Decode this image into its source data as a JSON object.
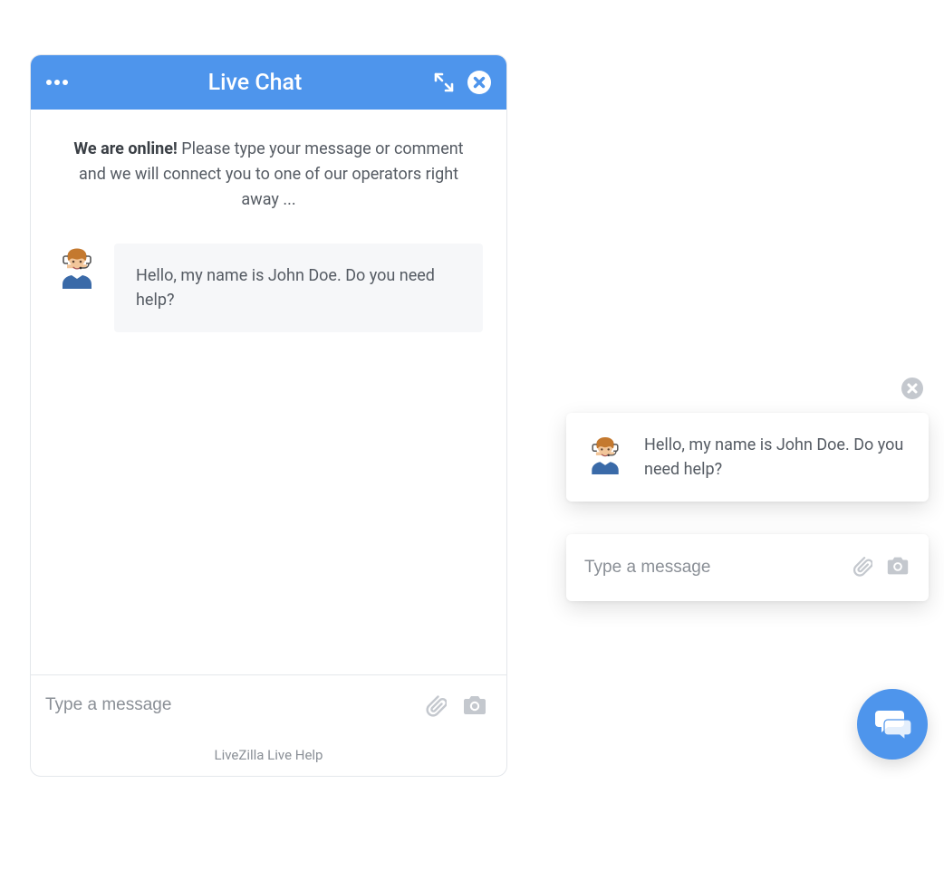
{
  "colors": {
    "accent": "#4e95ec",
    "icon_muted": "#c4c8ce",
    "text_muted": "#8a8f96"
  },
  "chat_window": {
    "header": {
      "title": "Live Chat"
    },
    "intro": {
      "bold": "We are online!",
      "text": " Please type your message or comment and we will connect you to one of our operators right away ..."
    },
    "message": {
      "text": "Hello, my name is John Doe. Do you need help?"
    },
    "input": {
      "placeholder": "Type a message"
    },
    "footer": "LiveZilla Live Help"
  },
  "mini_widget": {
    "message": "Hello, my name is John Doe. Do you need help?",
    "input_placeholder": "Type a message"
  }
}
